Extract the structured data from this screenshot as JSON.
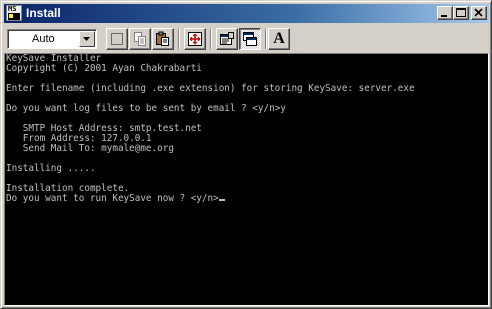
{
  "window": {
    "title": "Install",
    "icon": "ms-dos-prompt-icon",
    "icon_text": "MS"
  },
  "caption_buttons": {
    "minimize": "minimize-icon",
    "maximize": "maximize-icon",
    "close": "close-icon"
  },
  "toolbar": {
    "font_size_value": "Auto",
    "font_button_label": "A",
    "buttons": [
      {
        "name": "mark-button",
        "icon": "mark-icon"
      },
      {
        "name": "copy-button",
        "icon": "copy-icon"
      },
      {
        "name": "paste-button",
        "icon": "paste-icon"
      },
      {
        "name": "full-screen-button",
        "icon": "full-screen-icon"
      },
      {
        "name": "properties-button",
        "icon": "properties-icon"
      },
      {
        "name": "background-button",
        "icon": "background-icon",
        "pressed": true
      },
      {
        "name": "font-button",
        "icon": "font-icon"
      }
    ]
  },
  "console": {
    "lines": [
      "KeySave Installer",
      "Copyright (C) 2001 Ayan Chakrabarti",
      "",
      "Enter filename (including .exe extension) for storing KeySave: server.exe",
      "",
      "Do you want log files to be sent by email ? <y/n>y",
      "",
      "   SMTP Host Address: smtp.test.net",
      "   From Address: 127.0.0.1",
      "   Send Mail To: mymale@me.org",
      "",
      "Installing .....",
      "",
      "Installation complete.",
      "Do you want to run KeySave now ? <y/n>"
    ]
  },
  "colors": {
    "titlebar_start": "#0a246a",
    "titlebar_end": "#a6caf0",
    "console_bg": "#000000",
    "console_text": "#c0c0c0",
    "chrome": "#d4d0c8"
  }
}
